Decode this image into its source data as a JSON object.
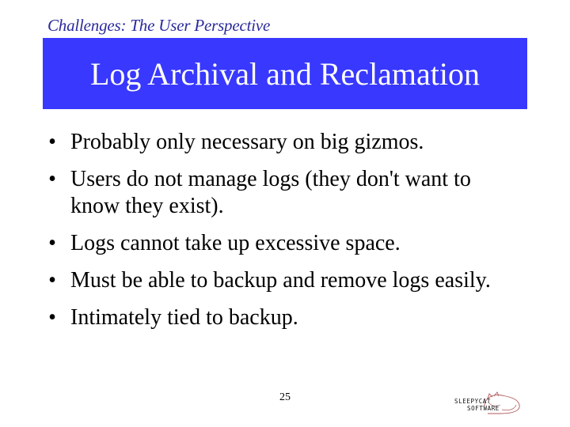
{
  "slide": {
    "section_label": "Challenges: The User Perspective",
    "title": "Log Archival and Reclamation",
    "bullets": [
      {
        "marker": "•",
        "text": "Probably only necessary on big gizmos."
      },
      {
        "marker": "•",
        "text": "Users do not manage logs (they don't want to know they exist)."
      },
      {
        "marker": "•",
        "text": "Logs cannot take up excessive space."
      },
      {
        "marker": "•",
        "text": "Must be able to backup and remove logs easily."
      },
      {
        "marker": "•",
        "text": "Intimately tied to backup."
      }
    ],
    "page_number": "25"
  },
  "logo": {
    "icon": "sleeping-cat-logo",
    "line1": "SLEEPYCAT",
    "line2": "SOFTWARE"
  },
  "colors": {
    "banner": "#3838ff",
    "section_label": "#2a2a9c",
    "title_text": "#ffffff",
    "logo_cat": "#b05a5a"
  }
}
